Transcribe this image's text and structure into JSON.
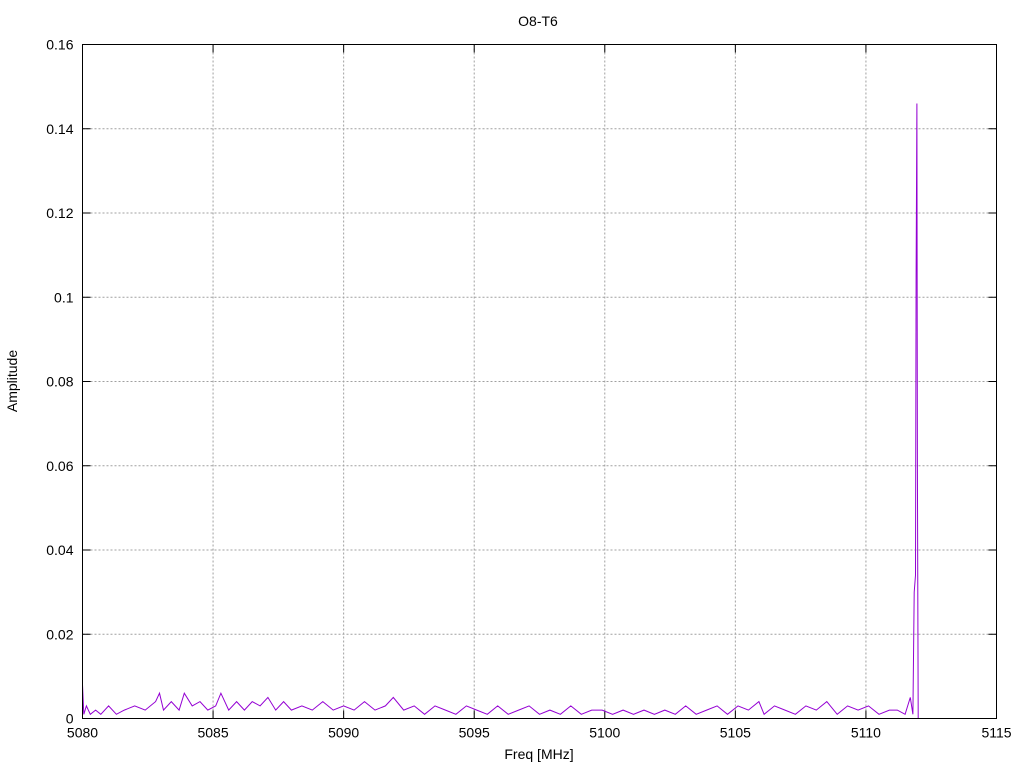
{
  "chart_data": {
    "type": "line",
    "title": "O8-T6",
    "xlabel": "Freq [MHz]",
    "ylabel": "Amplitude",
    "xlim": [
      5080,
      5115
    ],
    "ylim": [
      0,
      0.16
    ],
    "x_ticks": [
      "5080",
      "5085",
      "5090",
      "5095",
      "5100",
      "5105",
      "5110",
      "5115"
    ],
    "y_ticks": [
      "0",
      "0.02",
      "0.04",
      "0.06",
      "0.08",
      "0.1",
      "0.12",
      "0.14",
      "0.16"
    ],
    "grid": true,
    "series": [
      {
        "color": "#9400d3",
        "x": [
          5080.0,
          5080.05,
          5080.15,
          5080.3,
          5080.5,
          5080.7,
          5081.0,
          5081.3,
          5081.6,
          5082.0,
          5082.4,
          5082.8,
          5082.95,
          5083.1,
          5083.4,
          5083.7,
          5083.9,
          5084.2,
          5084.5,
          5084.8,
          5085.1,
          5085.3,
          5085.6,
          5085.9,
          5086.2,
          5086.5,
          5086.8,
          5087.1,
          5087.4,
          5087.7,
          5088.0,
          5088.4,
          5088.8,
          5089.2,
          5089.6,
          5090.0,
          5090.4,
          5090.8,
          5091.2,
          5091.6,
          5091.9,
          5092.3,
          5092.7,
          5093.1,
          5093.5,
          5093.9,
          5094.3,
          5094.7,
          5095.1,
          5095.5,
          5095.9,
          5096.3,
          5096.7,
          5097.1,
          5097.5,
          5097.9,
          5098.3,
          5098.7,
          5099.1,
          5099.5,
          5099.9,
          5100.3,
          5100.7,
          5101.1,
          5101.5,
          5101.9,
          5102.3,
          5102.7,
          5103.1,
          5103.5,
          5103.9,
          5104.3,
          5104.7,
          5105.1,
          5105.5,
          5105.9,
          5106.1,
          5106.5,
          5106.9,
          5107.3,
          5107.7,
          5108.1,
          5108.5,
          5108.9,
          5109.3,
          5109.7,
          5110.1,
          5110.5,
          5110.9,
          5111.2,
          5111.5,
          5111.7,
          5111.8,
          5111.85,
          5111.9,
          5111.92,
          5111.95,
          5111.97,
          5112.0
        ],
        "y": [
          0.008,
          0.001,
          0.003,
          0.001,
          0.002,
          0.001,
          0.003,
          0.001,
          0.002,
          0.003,
          0.002,
          0.004,
          0.006,
          0.002,
          0.004,
          0.002,
          0.006,
          0.003,
          0.004,
          0.002,
          0.003,
          0.006,
          0.002,
          0.004,
          0.002,
          0.004,
          0.003,
          0.005,
          0.002,
          0.004,
          0.002,
          0.003,
          0.002,
          0.004,
          0.002,
          0.003,
          0.002,
          0.004,
          0.002,
          0.003,
          0.005,
          0.002,
          0.003,
          0.001,
          0.003,
          0.002,
          0.001,
          0.003,
          0.002,
          0.001,
          0.003,
          0.001,
          0.002,
          0.003,
          0.001,
          0.002,
          0.001,
          0.003,
          0.001,
          0.002,
          0.002,
          0.001,
          0.002,
          0.001,
          0.002,
          0.001,
          0.002,
          0.001,
          0.003,
          0.001,
          0.002,
          0.003,
          0.001,
          0.003,
          0.002,
          0.004,
          0.001,
          0.003,
          0.002,
          0.001,
          0.003,
          0.002,
          0.004,
          0.001,
          0.003,
          0.002,
          0.003,
          0.001,
          0.002,
          0.002,
          0.001,
          0.005,
          0.001,
          0.03,
          0.034,
          0.105,
          0.146,
          0.06,
          0.0
        ]
      }
    ]
  }
}
